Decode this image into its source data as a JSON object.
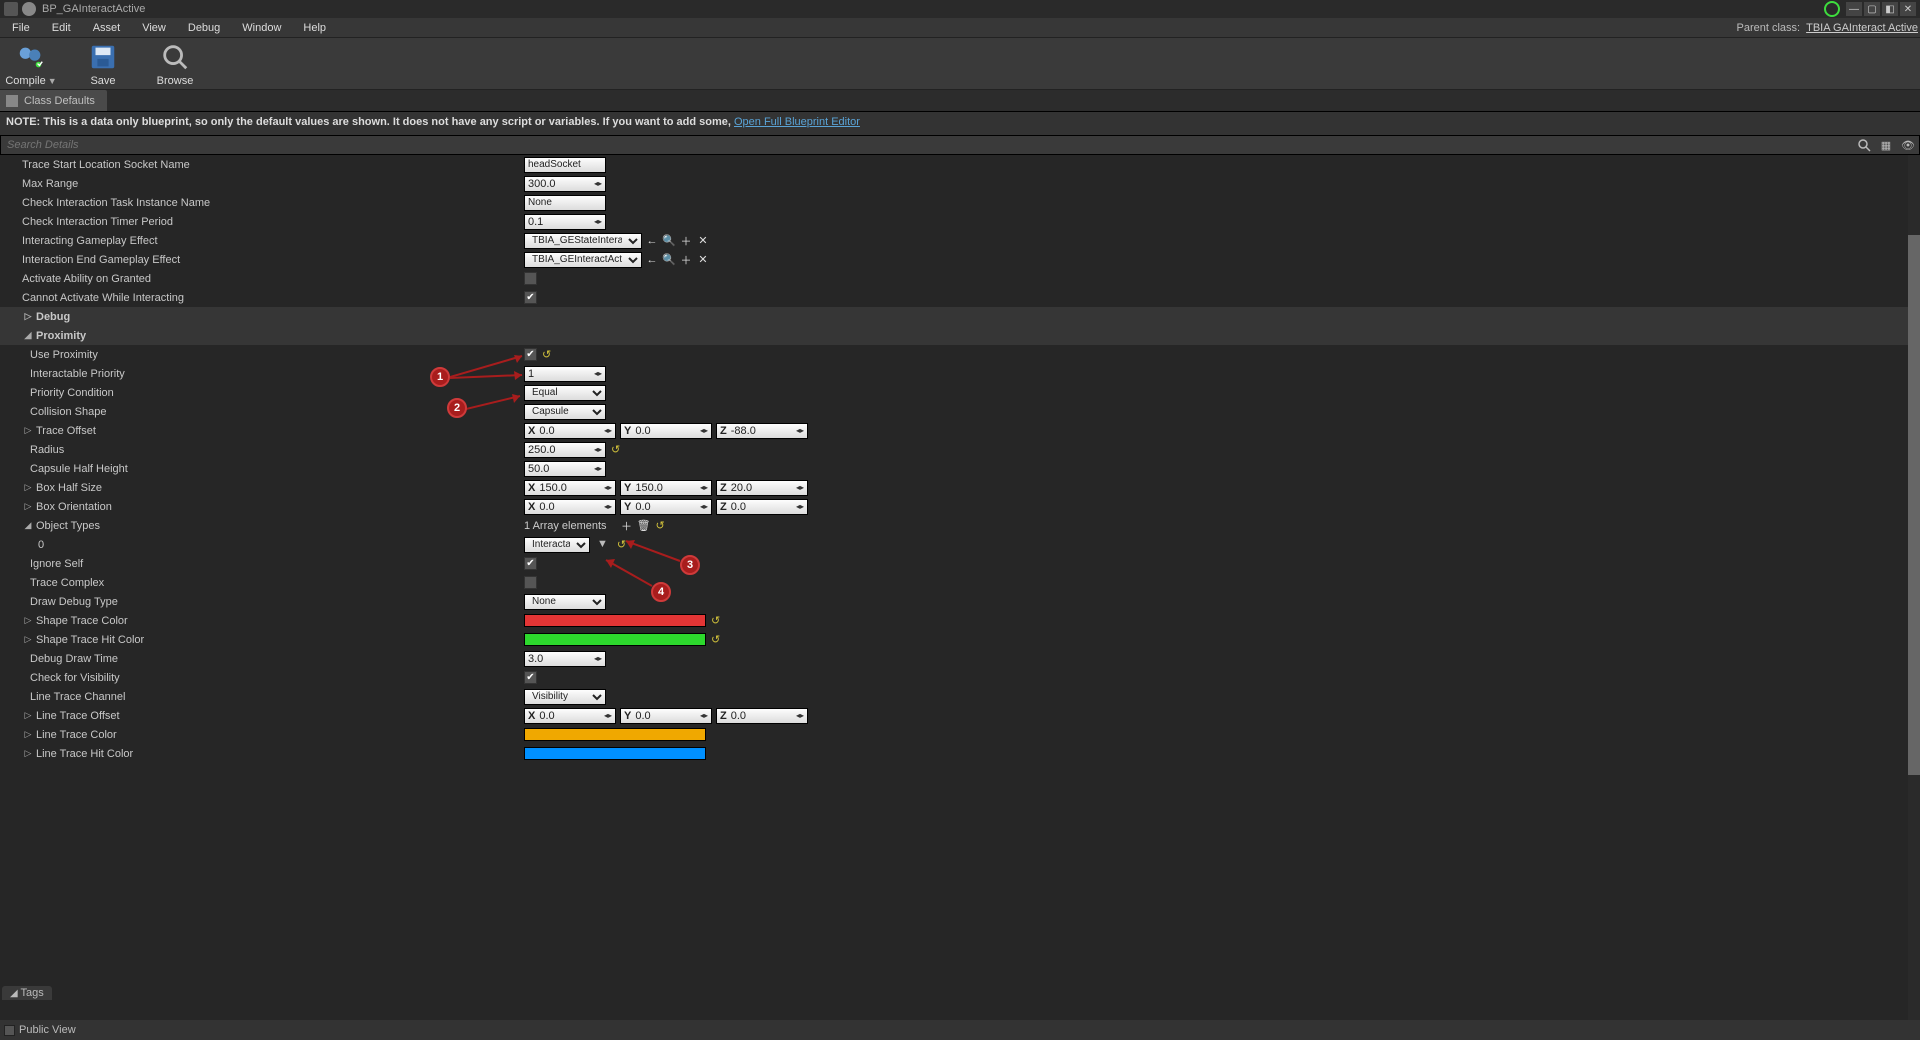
{
  "titlebar": {
    "doc_title": "BP_GAInteractActive"
  },
  "menu": {
    "file": "File",
    "edit": "Edit",
    "asset": "Asset",
    "view": "View",
    "debug": "Debug",
    "window": "Window",
    "help": "Help",
    "parent_label": "Parent class:",
    "parent_link": "TBIA GAInteract Active"
  },
  "toolbar": {
    "compile": "Compile",
    "save": "Save",
    "browse": "Browse"
  },
  "tab": {
    "label": "Class Defaults"
  },
  "note": {
    "text": "NOTE: This is a data only blueprint, so only the default values are shown.  It does not have any script or variables.  If you want to add some, ",
    "link": "Open Full Blueprint Editor"
  },
  "search": {
    "placeholder": "Search Details"
  },
  "labels": {
    "traceStart": "Trace Start Location Socket Name",
    "maxRange": "Max Range",
    "checkTaskName": "Check Interaction Task Instance Name",
    "checkTimer": "Check Interaction Timer Period",
    "interactingGE": "Interacting Gameplay Effect",
    "interactionEndGE": "Interaction End Gameplay Effect",
    "activateOnGranted": "Activate Ability on Granted",
    "cannotActivate": "Cannot Activate While Interacting",
    "debug": "Debug",
    "proximity": "Proximity",
    "useProximity": "Use Proximity",
    "interactablePriority": "Interactable Priority",
    "priorityCondition": "Priority Condition",
    "collisionShape": "Collision Shape",
    "traceOffset": "Trace Offset",
    "radius": "Radius",
    "capsuleHalf": "Capsule Half Height",
    "boxHalf": "Box Half Size",
    "boxOrient": "Box Orientation",
    "objectTypes": "Object Types",
    "idx0": "0",
    "ignoreSelf": "Ignore Self",
    "traceComplex": "Trace Complex",
    "drawDebugType": "Draw Debug Type",
    "shapeTraceColor": "Shape Trace Color",
    "shapeTraceHitColor": "Shape Trace Hit Color",
    "debugDrawTime": "Debug Draw Time",
    "checkVis": "Check for Visibility",
    "lineTraceChannel": "Line Trace Channel",
    "lineTraceOffset": "Line Trace Offset",
    "lineTraceColor": "Line Trace Color",
    "lineTraceHitColor": "Line Trace Hit Color",
    "tags": "Tags",
    "arrayElements": "1 Array elements"
  },
  "values": {
    "traceStart": "headSocket",
    "maxRange": "300.0",
    "checkTaskName": "None",
    "checkTimer": "0.1",
    "interactingGE": "TBIA_GEStateInteracting",
    "interactionEndGE": "TBIA_GEInteractActiveEnd",
    "interactablePriority": "1",
    "priorityCondition": "Equal",
    "collisionShape": "Capsule",
    "traceOffset": {
      "x": "0.0",
      "y": "0.0",
      "z": "-88.0"
    },
    "radius": "250.0",
    "capsuleHalf": "50.0",
    "boxHalf": {
      "x": "150.0",
      "y": "150.0",
      "z": "20.0"
    },
    "boxOrient": {
      "x": "0.0",
      "y": "0.0",
      "z": "0.0"
    },
    "objType0": "Interactable",
    "drawDebugType": "None",
    "debugDrawTime": "3.0",
    "lineTraceChannel": "Visibility",
    "lineTraceOffset": {
      "x": "0.0",
      "y": "0.0",
      "z": "0.0"
    }
  },
  "colors": {
    "shapeTrace": "#e33535",
    "shapeTraceHit": "#2dd82d",
    "lineTrace": "#f0a800",
    "lineTraceHit": "#0090ff"
  },
  "callouts": {
    "c1": "1",
    "c2": "2",
    "c3": "3",
    "c4": "4"
  },
  "footer": {
    "publicView": "Public View",
    "tags": "Tags"
  }
}
